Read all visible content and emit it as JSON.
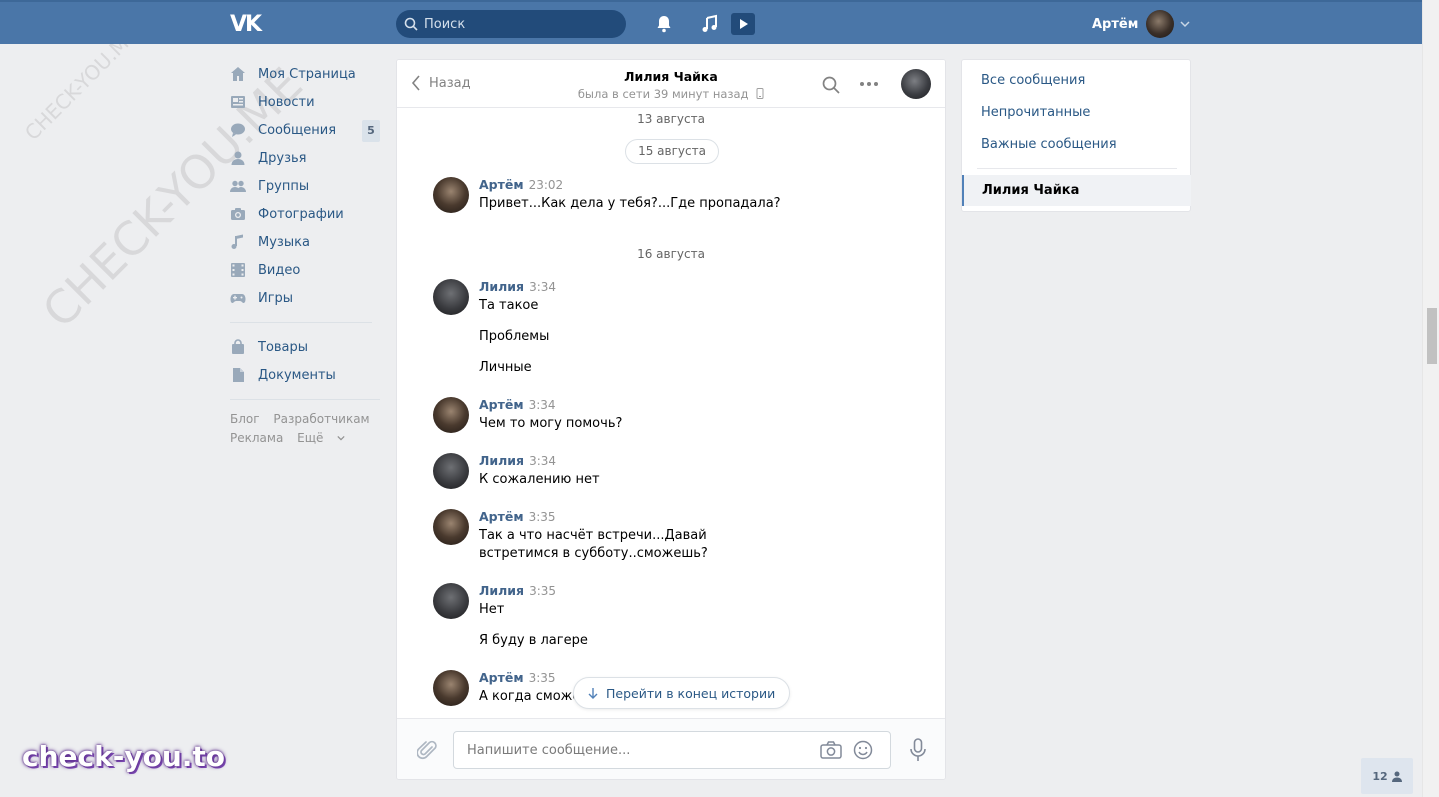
{
  "header": {
    "logo": "VK",
    "search_placeholder": "Поиск",
    "user_name": "Артём"
  },
  "sidebar": {
    "items": [
      {
        "label": "Моя Страница",
        "icon": "home-icon"
      },
      {
        "label": "Новости",
        "icon": "news-icon"
      },
      {
        "label": "Сообщения",
        "icon": "messages-icon",
        "badge": "5"
      },
      {
        "label": "Друзья",
        "icon": "friend-icon"
      },
      {
        "label": "Группы",
        "icon": "groups-icon"
      },
      {
        "label": "Фотографии",
        "icon": "camera-icon"
      },
      {
        "label": "Музыка",
        "icon": "music-note-icon"
      },
      {
        "label": "Видео",
        "icon": "film-icon"
      },
      {
        "label": "Игры",
        "icon": "gamepad-icon"
      }
    ],
    "items2": [
      {
        "label": "Товары",
        "icon": "shopping-bag-icon"
      },
      {
        "label": "Документы",
        "icon": "document-icon"
      }
    ],
    "footer": [
      "Блог",
      "Разработчикам",
      "Реклама",
      "Ещё"
    ]
  },
  "chat": {
    "back_label": "Назад",
    "peer_name": "Лилия Чайка",
    "peer_status": "была в сети 39 минут назад",
    "dates": [
      "13 августа",
      "15 августа",
      "16 августа"
    ],
    "messages": [
      {
        "author": "Артём",
        "time": "23:02",
        "lines": [
          "Привет...Как дела у тебя?...Где пропадала?"
        ]
      },
      {
        "author": "Лилия",
        "time": "3:34",
        "lines": [
          "Та такое",
          "Проблемы",
          "Личные"
        ]
      },
      {
        "author": "Артём",
        "time": "3:34",
        "lines": [
          "Чем то могу помочь?"
        ]
      },
      {
        "author": "Лилия",
        "time": "3:34",
        "lines": [
          "К сожалению нет"
        ]
      },
      {
        "author": "Артём",
        "time": "3:35",
        "lines": [
          "Так а что насчёт встречи...Давай встретимся в субботу..сможешь?"
        ]
      },
      {
        "author": "Лилия",
        "time": "3:35",
        "lines": [
          "Нет",
          "Я буду в лагере"
        ]
      },
      {
        "author": "Артём",
        "time": "3:35",
        "lines": [
          "А когда сможеш"
        ]
      }
    ],
    "jump_label": "Перейти в конец истории",
    "input_placeholder": "Напишите сообщение..."
  },
  "right_panel": {
    "items": [
      "Все сообщения",
      "Непрочитанные",
      "Важные сообщения"
    ],
    "active": "Лилия Чайка"
  },
  "watermark": {
    "big": "CHECK-YOU.ME",
    "small": "CHECK-YOU.ME",
    "brand": "check-you.to"
  },
  "online_count": "12",
  "colors": {
    "header_bg": "#4a76a8",
    "link": "#2a5885",
    "author": "#42648b",
    "page_bg": "#edeef0"
  }
}
